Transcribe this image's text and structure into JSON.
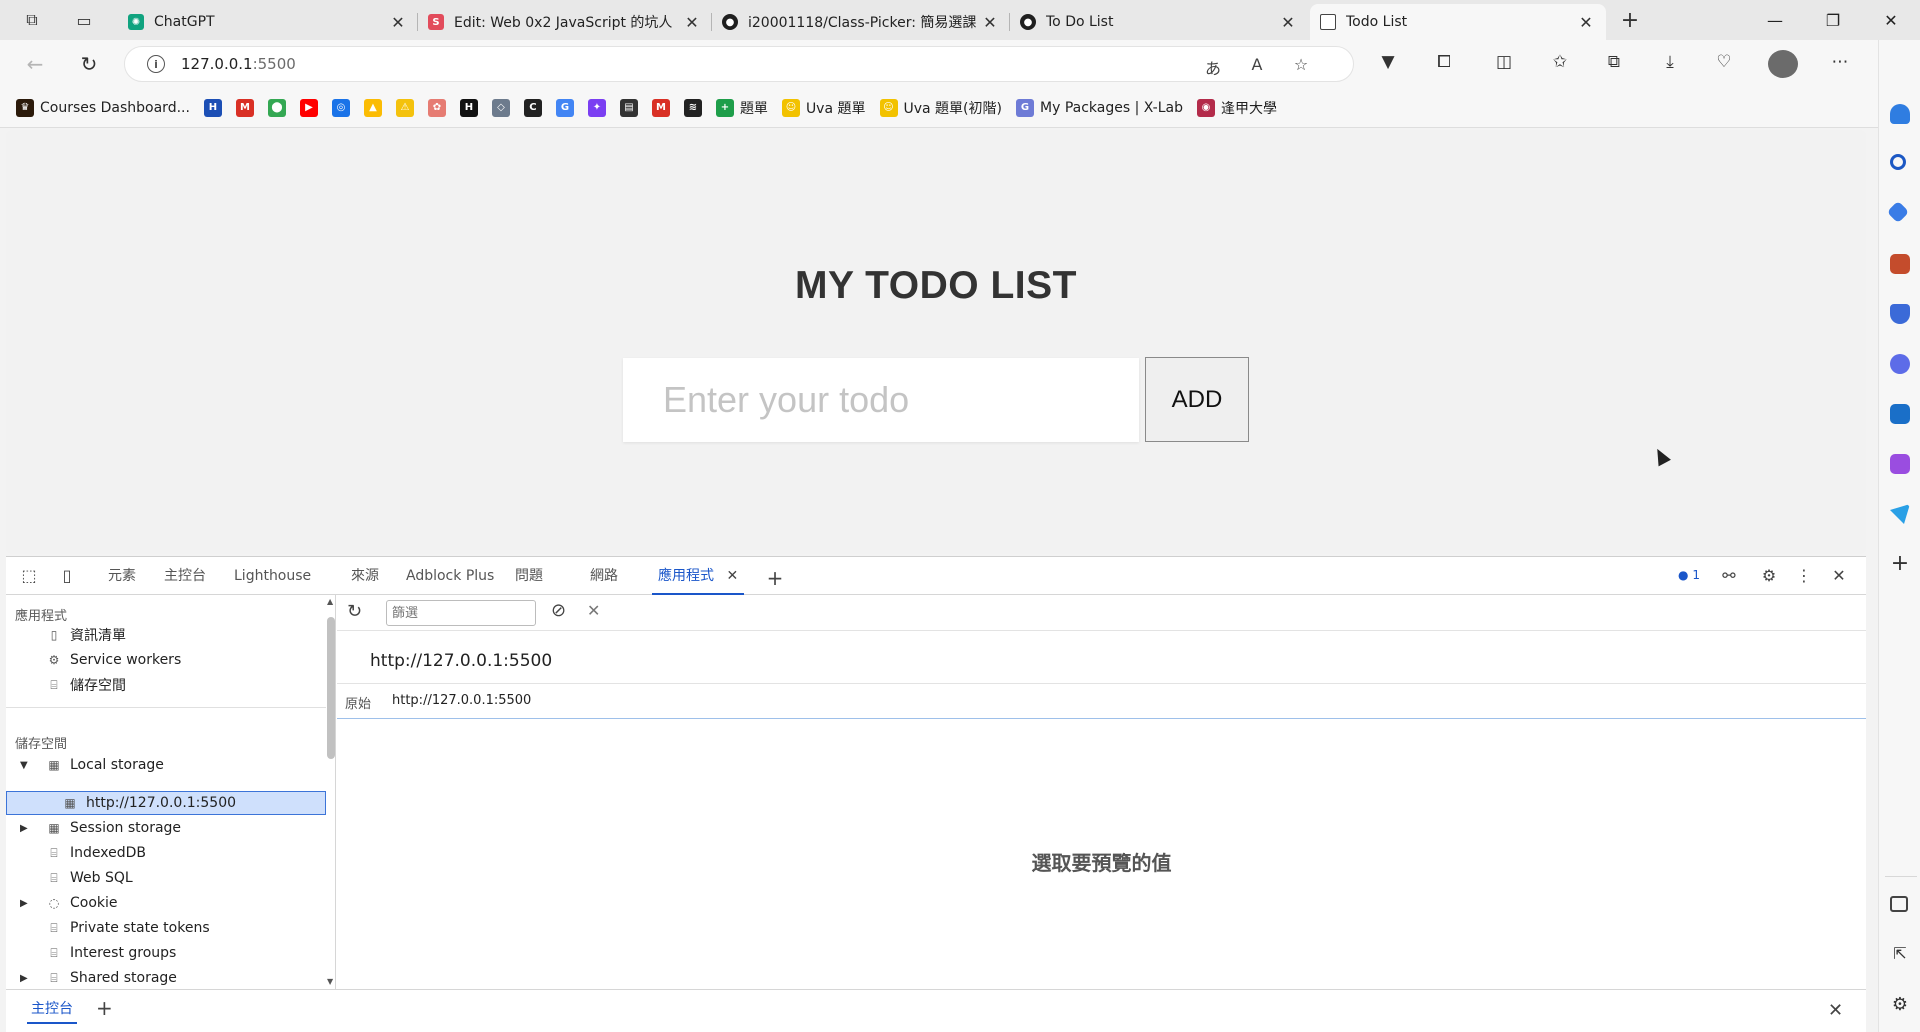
{
  "browser": {
    "tabs": [
      {
        "title": "ChatGPT",
        "favicon": "chatgpt-icon",
        "color": "#10a37f",
        "glyph": "✺"
      },
      {
        "title": "Edit: Web 0x2 JavaScript 的坑人",
        "favicon": "s-icon",
        "color": "#e24b5b",
        "glyph": "S"
      },
      {
        "title": "i20001118/Class-Picker: 簡易選課",
        "favicon": "github-icon",
        "color": "#1f1f1f",
        "glyph": "●"
      },
      {
        "title": "To Do List",
        "favicon": "github-icon",
        "color": "#1f1f1f",
        "glyph": "●"
      },
      {
        "title": "Todo List",
        "favicon": "page-icon",
        "color": "#ffffff",
        "glyph": "▯",
        "active": true
      }
    ],
    "new_tab_label": "+",
    "address": {
      "host": "127.0.0.1",
      "port": ":5500"
    },
    "bookmarks": [
      {
        "label": "Courses Dashboard...",
        "icon": "crown-icon",
        "color": "#2b1a0a",
        "glyph": "♛"
      },
      {
        "label": "",
        "icon": "h-icon",
        "color": "#1c4fb5",
        "glyph": "H"
      },
      {
        "label": "",
        "icon": "gmail-icon",
        "color": "#d93025",
        "glyph": "M"
      },
      {
        "label": "",
        "icon": "maps-icon",
        "color": "#34a853",
        "glyph": "⬤"
      },
      {
        "label": "",
        "icon": "youtube-icon",
        "color": "#ff0000",
        "glyph": "▶"
      },
      {
        "label": "",
        "icon": "chrome-icon",
        "color": "#1a73e8",
        "glyph": "◎"
      },
      {
        "label": "",
        "icon": "drive-icon",
        "color": "#fbbc04",
        "glyph": "▲"
      },
      {
        "label": "",
        "icon": "warning-icon",
        "color": "#f4c20d",
        "glyph": "⚠"
      },
      {
        "label": "",
        "icon": "gear-app-icon",
        "color": "#e67c73",
        "glyph": "✿"
      },
      {
        "label": "",
        "icon": "hacker-icon",
        "color": "#111111",
        "glyph": "H"
      },
      {
        "label": "",
        "icon": "shield-bm-icon",
        "color": "#6d7b8d",
        "glyph": "◇"
      },
      {
        "label": "",
        "icon": "c-icon",
        "color": "#222222",
        "glyph": "C"
      },
      {
        "label": "",
        "icon": "translate-icon",
        "color": "#4285f4",
        "glyph": "G"
      },
      {
        "label": "",
        "icon": "messenger-icon",
        "color": "#7b3ff2",
        "glyph": "✦"
      },
      {
        "label": "",
        "icon": "doc-icon",
        "color": "#333333",
        "glyph": "▤"
      },
      {
        "label": "",
        "icon": "gmail-icon",
        "color": "#d93025",
        "glyph": "M"
      },
      {
        "label": "",
        "icon": "layers-icon",
        "color": "#222222",
        "glyph": "≋"
      },
      {
        "label": "題單",
        "icon": "green-plus-icon",
        "color": "#1e9e4a",
        "glyph": "+"
      },
      {
        "label": "Uva 題單",
        "icon": "smiley-icon",
        "color": "#f2c200",
        "glyph": "☺"
      },
      {
        "label": "Uva 題單(初階)",
        "icon": "smiley-icon",
        "color": "#f2c200",
        "glyph": "☺"
      },
      {
        "label": "My Packages | X-Lab",
        "icon": "xlab-icon",
        "color": "#6e7bd6",
        "glyph": "G"
      },
      {
        "label": "逢甲大學",
        "icon": "fcu-icon",
        "color": "#b32b4a",
        "glyph": "◉"
      }
    ]
  },
  "page": {
    "title": "MY TODO LIST",
    "input_placeholder": "Enter your todo",
    "add_label": "ADD"
  },
  "devtools": {
    "tabs": [
      "元素",
      "主控台",
      "Lighthouse",
      "來源",
      "Adblock Plus",
      "問題",
      "網路",
      "應用程式"
    ],
    "active_tab": "應用程式",
    "issues_count": "1",
    "sections": {
      "application_title": "應用程式",
      "application_items": [
        "資訊清單",
        "Service workers",
        "儲存空間"
      ],
      "storage_title": "儲存空間",
      "storage_items": [
        "Local storage",
        "http://127.0.0.1:5500",
        "Session storage",
        "IndexedDB",
        "Web SQL",
        "Cookie",
        "Private state tokens",
        "Interest groups",
        "Shared storage"
      ]
    },
    "filter_placeholder": "篩選",
    "origin_heading": "http://127.0.0.1:5500",
    "origin_label": "原始",
    "origin_value": "http://127.0.0.1:5500",
    "preview_message": "選取要預覽的值",
    "drawer_tab": "主控台"
  }
}
